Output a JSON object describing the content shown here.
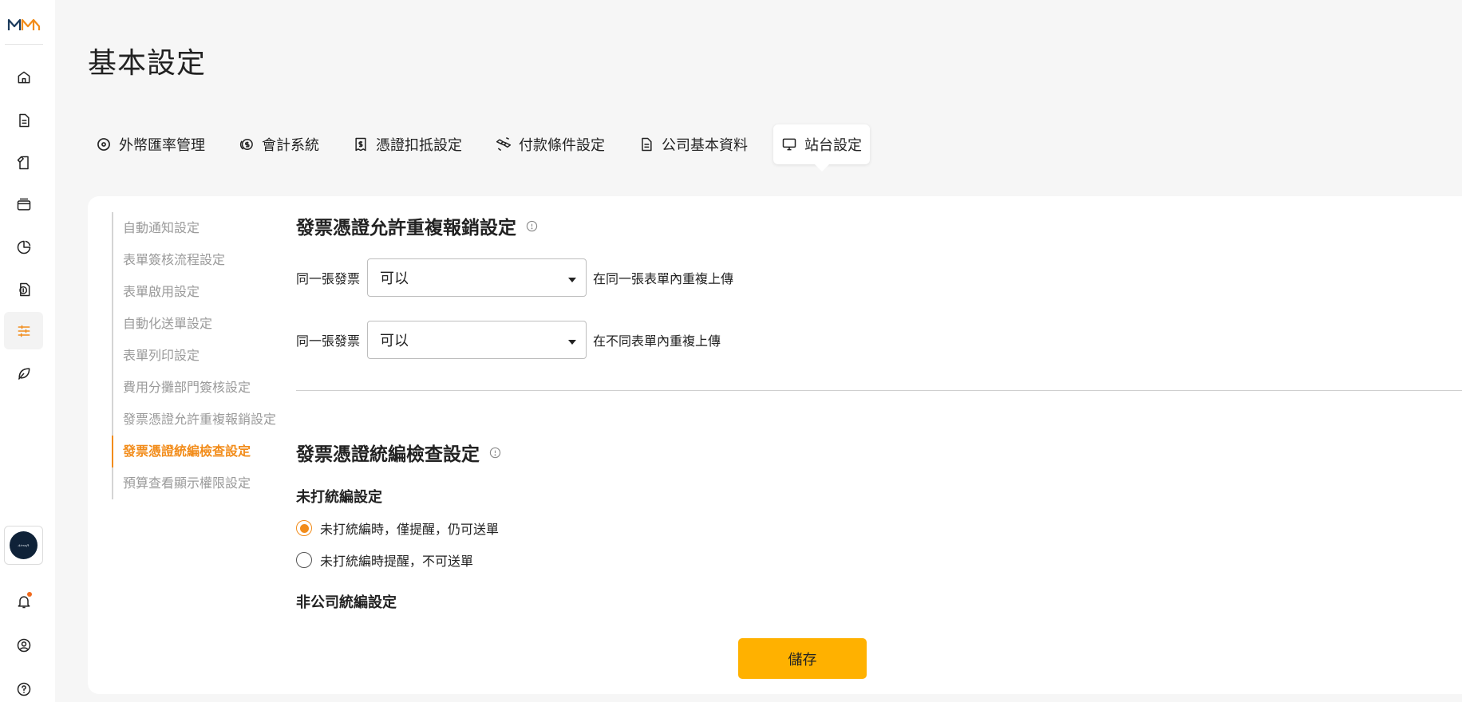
{
  "page": {
    "title": "基本設定"
  },
  "tabs": [
    {
      "label": "外幣匯率管理",
      "icon": "target-icon"
    },
    {
      "label": "會計系統",
      "icon": "coins-icon"
    },
    {
      "label": "憑證扣抵設定",
      "icon": "receipt-dollar-icon"
    },
    {
      "label": "付款條件設定",
      "icon": "handshake-icon"
    },
    {
      "label": "公司基本資料",
      "icon": "document-icon"
    },
    {
      "label": "站台設定",
      "icon": "monitor-icon",
      "active": true
    }
  ],
  "sub_nav": [
    {
      "label": "自動通知設定"
    },
    {
      "label": "表單簽核流程設定"
    },
    {
      "label": "表單啟用設定"
    },
    {
      "label": "自動化送單設定"
    },
    {
      "label": "表單列印設定"
    },
    {
      "label": "費用分攤部門簽核設定"
    },
    {
      "label": "發票憑證允許重複報銷設定"
    },
    {
      "label": "發票憑證統編檢查設定",
      "active": true
    },
    {
      "label": "預算查看顯示權限設定"
    }
  ],
  "duplicate_section": {
    "title": "發票憑證允許重複報銷設定",
    "rows": [
      {
        "prefix": "同一張發票",
        "value": "可以",
        "suffix": "在同一張表單內重複上傳"
      },
      {
        "prefix": "同一張發票",
        "value": "可以",
        "suffix": "在不同表單內重複上傳"
      }
    ]
  },
  "tax_id_section": {
    "title": "發票憑證統編檢查設定",
    "missing_heading": "未打統編設定",
    "options": [
      {
        "label": "未打統編時，僅提醒，仍可送單",
        "checked": true
      },
      {
        "label": "未打統編時提醒，不可送單",
        "checked": false
      }
    ],
    "non_company_heading": "非公司統編設定"
  },
  "actions": {
    "save_label": "儲存"
  },
  "colors": {
    "accent": "#f28c1a",
    "save_button": "#ffb100",
    "notification_dot": "#f06a1d"
  }
}
